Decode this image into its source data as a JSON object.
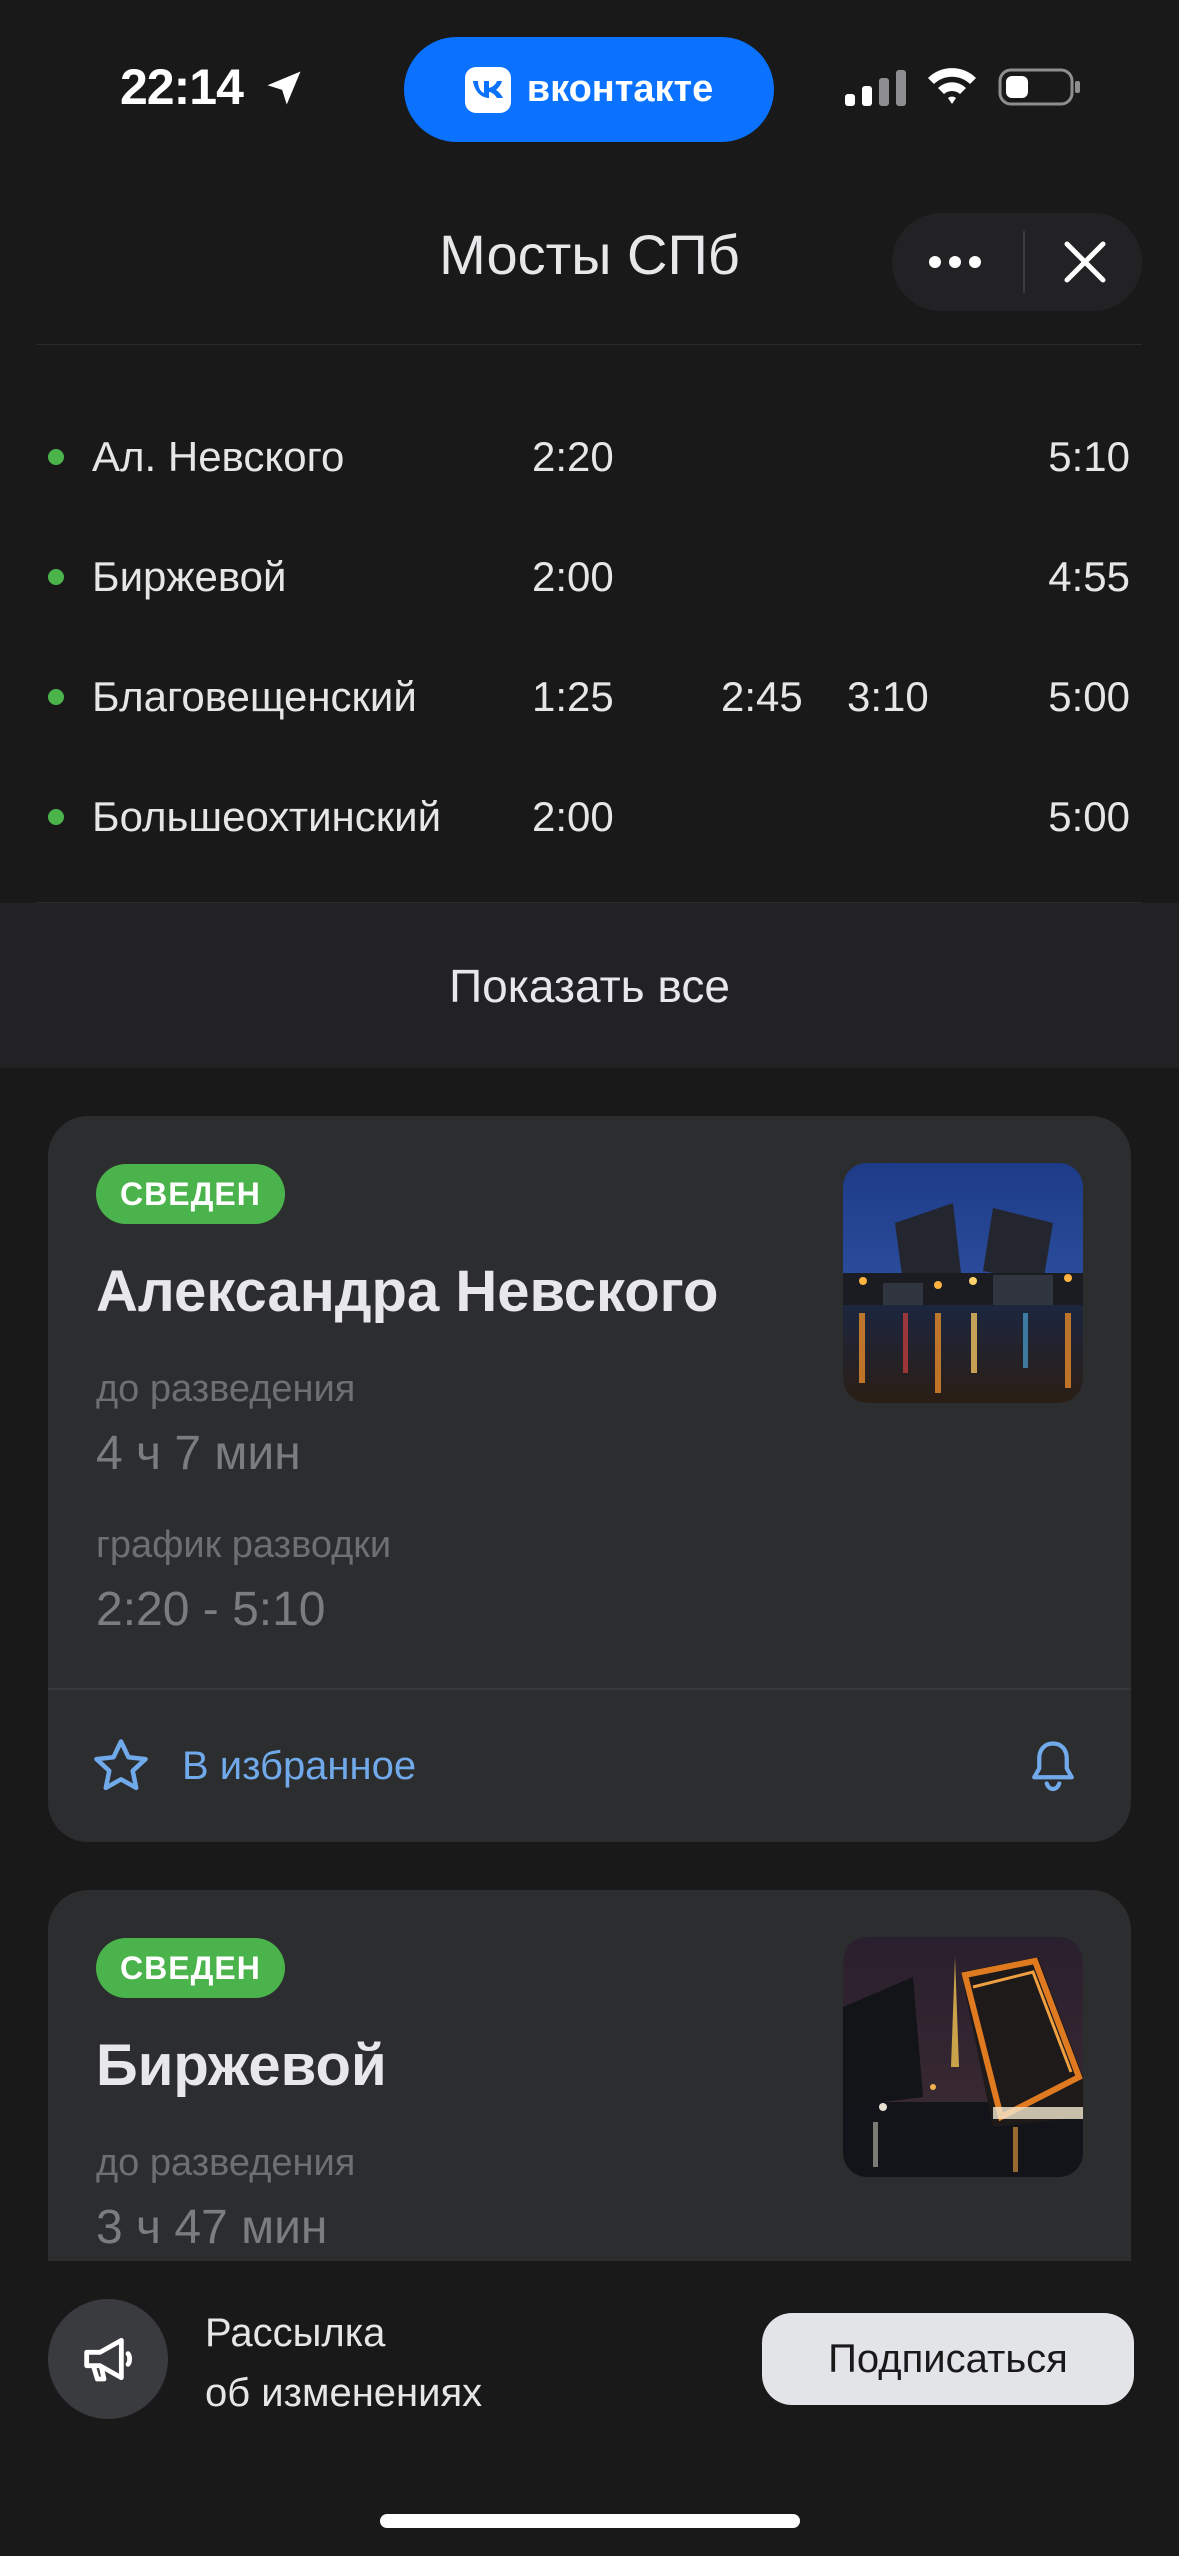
{
  "status_bar": {
    "time": "22:14",
    "vk_label": "вконтакте",
    "icons": [
      "location-arrow-icon",
      "signal-icon",
      "wifi-icon",
      "battery-icon"
    ]
  },
  "header": {
    "title": "Мосты СПб",
    "more_icon": "more-horizontal-icon",
    "close_icon": "close-icon"
  },
  "schedule": {
    "rows": [
      {
        "name": "Ал. Невского",
        "t1": "2:20",
        "t2": "",
        "t3": "",
        "t4": "5:10"
      },
      {
        "name": "Биржевой",
        "t1": "2:00",
        "t2": "",
        "t3": "",
        "t4": "4:55"
      },
      {
        "name": "Благовещенский",
        "t1": "1:25",
        "t2": "2:45",
        "t3": "3:10",
        "t4": "5:00"
      },
      {
        "name": "Большеохтинский",
        "t1": "2:00",
        "t2": "",
        "t3": "",
        "t4": "5:00"
      }
    ],
    "show_all": "Показать все"
  },
  "cards": [
    {
      "badge": "СВЕДЕН",
      "title": "Александра Невского",
      "until_label": "до разведения",
      "until_value": "4 ч 7 мин",
      "schedule_label": "график разводки",
      "schedule_value": "2:20 - 5:10",
      "favorite_label": "В избранное"
    },
    {
      "badge": "СВЕДЕН",
      "title": "Биржевой",
      "until_label": "до разведения",
      "until_value": "3 ч 47 мин"
    }
  ],
  "subscribe": {
    "line1": "Рассылка",
    "line2": "об изменениях",
    "button": "Подписаться"
  },
  "colors": {
    "background": "#19191a",
    "card": "#2c2d2f",
    "accent_green": "#4bb34b",
    "link_blue": "#71aaeb",
    "vk_blue": "#0a72ff"
  }
}
